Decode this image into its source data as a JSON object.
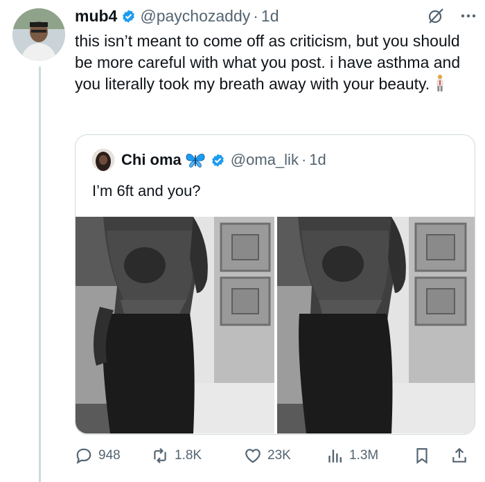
{
  "tweet": {
    "author_name": "mub4",
    "handle": "@paychozaddy",
    "separator": "·",
    "time": "1d",
    "text": "this isn’t meant to come off as criticism, but you should be more careful with what you post. i have asthma and you literally took my breath away with your beauty.",
    "emoji": "person-standing-emoji"
  },
  "quoted": {
    "author_name": "Chi oma",
    "handle": "@oma_lik",
    "separator": "·",
    "time": "1d",
    "text": "I’m 6ft and you?"
  },
  "actions": {
    "replies": "948",
    "reposts": "1.8K",
    "likes": "23K",
    "views": "1.3M"
  },
  "colors": {
    "verified": "#1d9bf0",
    "secondary_text": "#536471",
    "border": "#cfd9de",
    "butterfly": "#1d9bf0"
  }
}
